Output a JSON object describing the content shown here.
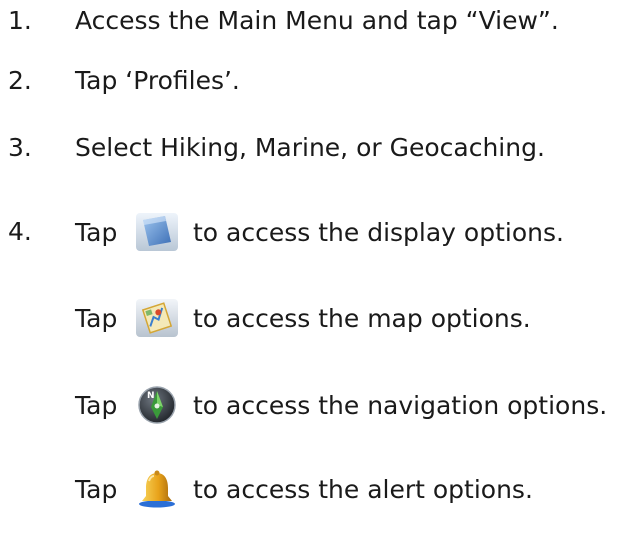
{
  "steps": [
    {
      "number": "1.",
      "text": "Access the Main Menu and tap “View”."
    },
    {
      "number": "2.",
      "text": "Tap ‘Profiles’."
    },
    {
      "number": "3.",
      "text": "Select Hiking, Marine, or Geocaching."
    },
    {
      "number": "4."
    }
  ],
  "tap_rows": [
    {
      "tap": "Tap",
      "icon": "display-icon",
      "text": "to access the display options."
    },
    {
      "tap": "Tap",
      "icon": "map-icon",
      "text": "to access the map options."
    },
    {
      "tap": "Tap",
      "icon": "navigation-compass-icon",
      "text": "to access the navigation options."
    },
    {
      "tap": "Tap",
      "icon": "bell-icon",
      "text": "to access the alert options."
    }
  ],
  "colors": {
    "text": "#1a1a1a",
    "bell": "#e8a21a",
    "compass_green": "#3a9a3a"
  }
}
